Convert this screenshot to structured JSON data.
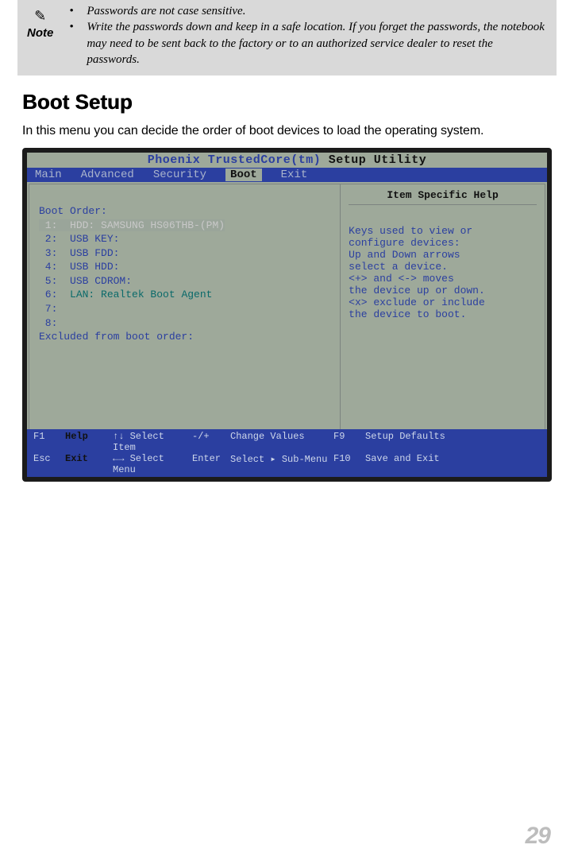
{
  "note": {
    "label": "Note",
    "items": [
      "Passwords are not case sensitive.",
      "Write the passwords down and keep in a safe location. If you forget the passwords, the notebook may need to be sent back to the factory or to an authorized service dealer to reset the passwords."
    ]
  },
  "heading": "Boot Setup",
  "intro": "In this menu you can decide the order of boot devices to load the operating system.",
  "bios": {
    "title_left": "Phoenix TrustedCore(tm)",
    "title_right": " Setup Utility",
    "tabs": [
      "Main",
      "Advanced",
      "Security",
      "Boot",
      "Exit"
    ],
    "selected_tab": "Boot",
    "boot_order_label": "Boot Order:",
    "boot_order": [
      "HDD: SAMSUNG HS06THB-(PM)",
      "USB KEY:",
      "USB FDD:",
      "USB HDD:",
      "USB CDROM:",
      "LAN: Realtek Boot Agent",
      "",
      ""
    ],
    "excluded_label": "Excluded from boot order:",
    "help_header": "Item Specific Help",
    "help_lines": [
      "Keys used to view or",
      "configure devices:",
      "",
      "Up and Down arrows",
      "select a device.",
      "<+> and <-> moves",
      "the device up or down.",
      "<x> exclude or include",
      "the device to boot."
    ],
    "footer": {
      "f1": "F1",
      "help": "Help",
      "select_item": "Select Item",
      "pm": "-/+",
      "change_values": "Change Values",
      "f9": "F9",
      "setup_defaults": "Setup Defaults",
      "esc": "Esc",
      "exit": "Exit",
      "select_menu": "Select Menu",
      "enter": "Enter",
      "select_sub": "Select ▸ Sub-Menu",
      "f10": "F10",
      "save_exit": "Save and Exit"
    }
  },
  "page_number": "29"
}
